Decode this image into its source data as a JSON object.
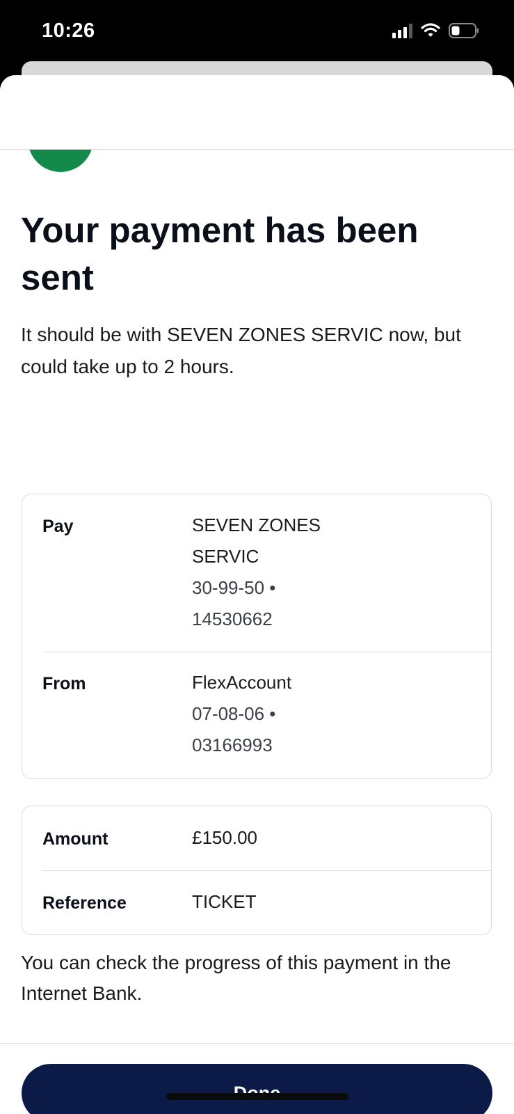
{
  "status_bar": {
    "time": "10:26",
    "icons": [
      "signal-icon",
      "wifi-icon",
      "battery-icon"
    ]
  },
  "confirmation": {
    "icon": "check-icon",
    "title": "Your payment has been sent",
    "subtitle": "It should be with SEVEN ZONES SERVIC now, but could take up to 2 hours."
  },
  "details": {
    "pay": {
      "label": "Pay",
      "name_line1": "SEVEN ZONES",
      "name_line2": "SERVIC",
      "sort_code": "30-99-50 •",
      "account_number": "14530662"
    },
    "from": {
      "label": "From",
      "name": "FlexAccount",
      "sort_code": "07-08-06 •",
      "account_number": "03166993"
    }
  },
  "payment": {
    "amount_label": "Amount",
    "amount_value": "£150.00",
    "reference_label": "Reference",
    "reference_value": "TICKET"
  },
  "footer_text": "You can check the progress of this payment in the Internet Bank.",
  "done_label": "Done",
  "colors": {
    "success": "#138a4a",
    "primary_button": "#0b1a47",
    "text": "#0b0f1a",
    "border": "#dcdcdc"
  }
}
